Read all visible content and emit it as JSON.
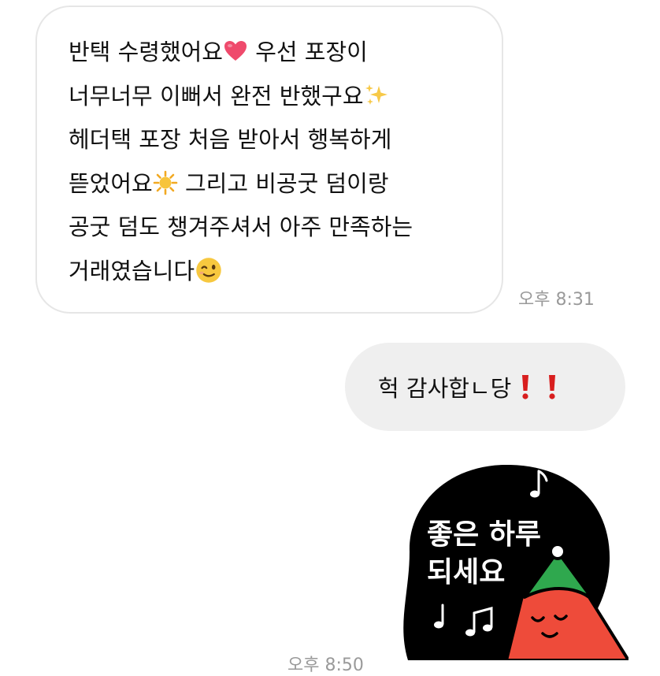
{
  "conversation": {
    "incoming": {
      "lines": [
        {
          "before": "반택 수령했어요",
          "emoji": "heart-icon",
          "after": " 우선 포장이"
        },
        {
          "before": "너무너무 이뻐서 완전 반했구요",
          "emoji": "sparkles-icon",
          "after": ""
        },
        {
          "before": "헤더택 포장 처음 받아서 행복하게",
          "emoji": "",
          "after": ""
        },
        {
          "before": "뜯었어요",
          "emoji": "sun-icon",
          "after": " 그리고 비공굿 덤이랑"
        },
        {
          "before": "공굿 덤도 챙겨주셔서 아주 만족하는",
          "emoji": "",
          "after": ""
        },
        {
          "before": "거래였습니다",
          "emoji": "wink-icon",
          "after": ""
        }
      ],
      "time": "오후 8:31"
    },
    "outgoing": {
      "text": "헉 감사합ㄴ당",
      "emoji": "double-exclamation-icon"
    },
    "sticker": {
      "text_line1": "좋은 하루",
      "text_line2": "되세요",
      "time": "오후 8:50"
    }
  },
  "colors": {
    "incoming_bg": "#ffffff",
    "incoming_border": "#e6e6e6",
    "outgoing_bg": "#efefef",
    "timestamp": "#9a9a9a",
    "heart": "#ef4a6c",
    "exclamation": "#d81e1e",
    "sticker_bg": "#000000",
    "sticker_red": "#ee4b3a",
    "sticker_green": "#2fa84e"
  }
}
